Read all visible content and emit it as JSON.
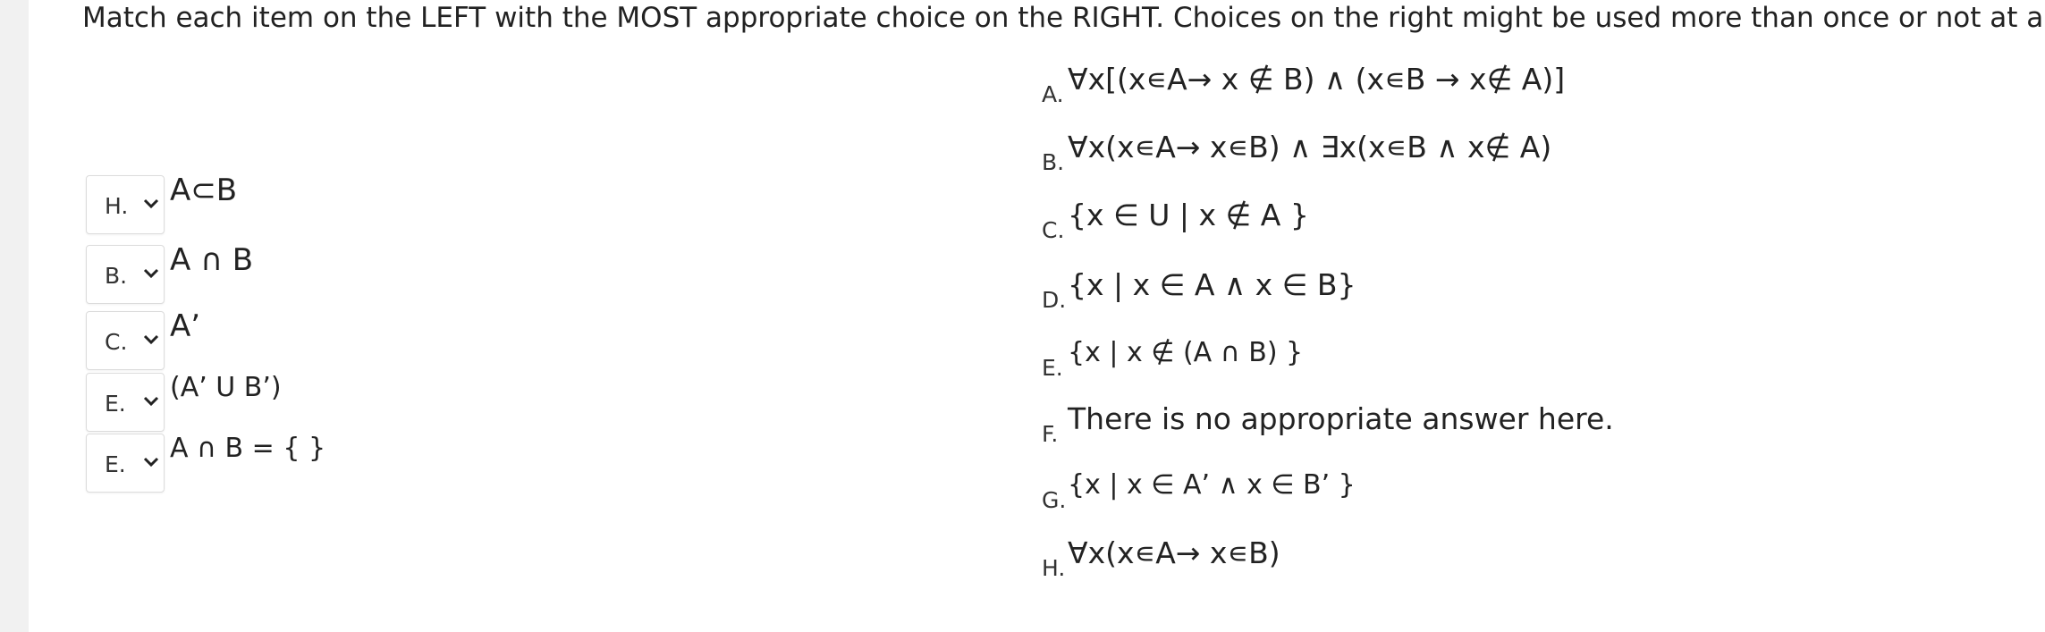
{
  "instructions": "Match each item on the LEFT with the MOST appropriate choice on the RIGHT. Choices on the right might be used more than once or not at all.",
  "prompts": [
    {
      "selected": "H.",
      "text": "A⊂B"
    },
    {
      "selected": "B.",
      "text": "A ∩ B"
    },
    {
      "selected": "C.",
      "text": "A’"
    },
    {
      "selected": "E.",
      "text": "(A’ U B’)"
    },
    {
      "selected": "E.",
      "text": "A ∩ B = { }"
    }
  ],
  "choices": [
    {
      "letter": "A.",
      "text": "∀x[(x∊A→ x ∉ B) ∧ (x∊B → x∉ A)]"
    },
    {
      "letter": "B.",
      "text": "∀x(x∊A→ x∊B) ∧ ∃x(x∊B ∧ x∉ A)"
    },
    {
      "letter": "C.",
      "text": "{x ∈ U | x ∉ A }"
    },
    {
      "letter": "D.",
      "text": "{x | x ∈ A ∧ x ∈ B}"
    },
    {
      "letter": "E.",
      "text": "{x | x ∉ (A ∩ B) }"
    },
    {
      "letter": "F.",
      "text": "There is no appropriate answer here."
    },
    {
      "letter": "G.",
      "text": "{x | x ∈ A’ ∧ x ∈ B’ }"
    },
    {
      "letter": "H.",
      "text": "∀x(x∊A→ x∊B)"
    }
  ]
}
